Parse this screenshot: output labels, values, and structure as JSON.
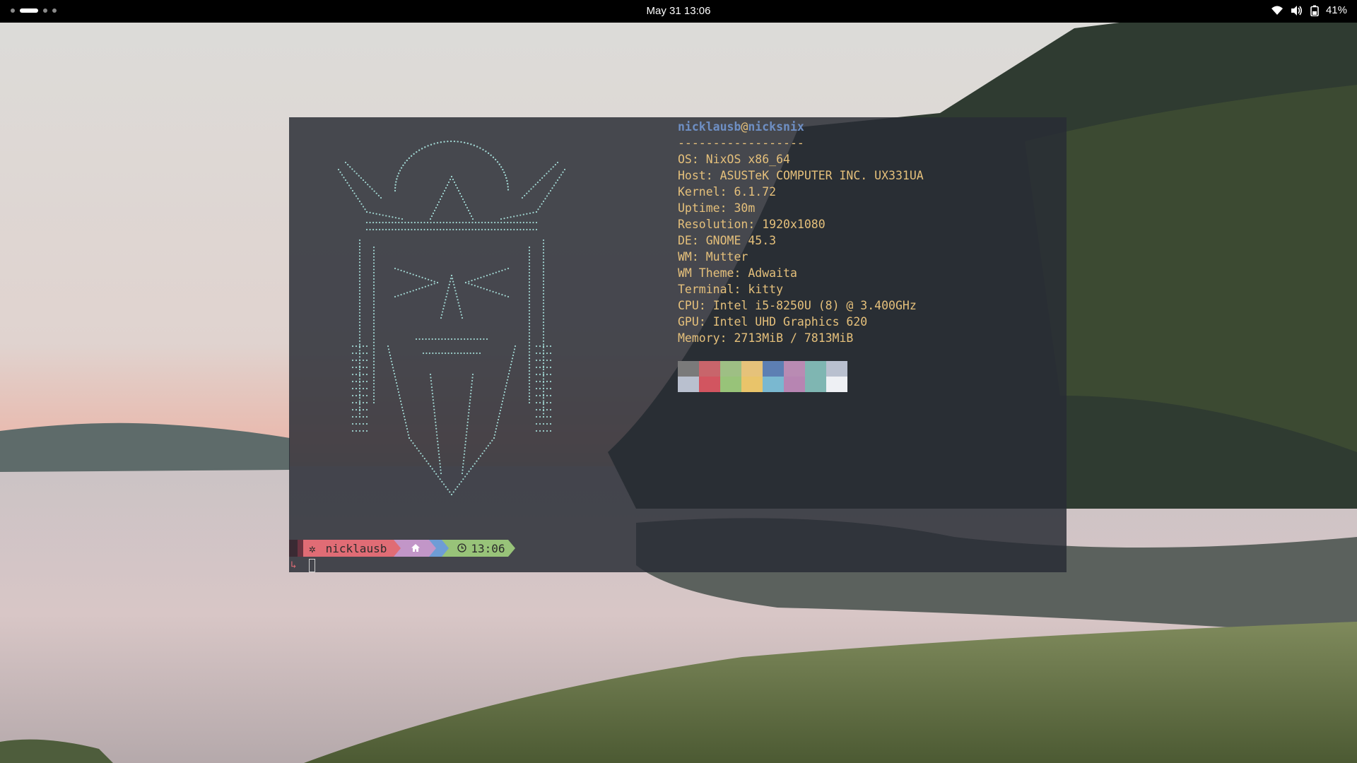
{
  "topbar": {
    "date_time": "May 31  13:06",
    "battery": "41%",
    "icons": [
      "workspaces-indicator",
      "wifi-icon",
      "volume-icon",
      "battery-icon"
    ]
  },
  "terminal": {
    "user": "nicklausb",
    "at": "@",
    "host": "nicksnix",
    "separator": "------------------",
    "info": [
      {
        "key": "OS",
        "value": "NixOS x86_64"
      },
      {
        "key": "Host",
        "value": "ASUSTeK COMPUTER INC. UX331UA"
      },
      {
        "key": "Kernel",
        "value": "6.1.72"
      },
      {
        "key": "Uptime",
        "value": "30m"
      },
      {
        "key": "Resolution",
        "value": "1920x1080"
      },
      {
        "key": "DE",
        "value": "GNOME 45.3"
      },
      {
        "key": "WM",
        "value": "Mutter"
      },
      {
        "key": "WM Theme",
        "value": "Adwaita"
      },
      {
        "key": "Terminal",
        "value": "kitty"
      },
      {
        "key": "CPU",
        "value": "Intel i5-8250U (8) @ 3.400GHz"
      },
      {
        "key": "GPU",
        "value": "Intel UHD Graphics 620"
      },
      {
        "key": "Memory",
        "value": "2713MiB / 7813MiB"
      }
    ],
    "palette_top": [
      "#7a7a7a",
      "#c8656b",
      "#9ebf84",
      "#e6c27a",
      "#5d7fb3",
      "#b98bb3",
      "#7fb6b2",
      "#b9c0cf"
    ],
    "palette_bottom": [
      "#b9c0cf",
      "#d25560",
      "#98c379",
      "#e9c46a",
      "#7ab8d0",
      "#b785b2",
      "#7fb6b2",
      "#eef0f4"
    ],
    "prompt": {
      "user": "nicklausb",
      "time": "13:06"
    }
  }
}
